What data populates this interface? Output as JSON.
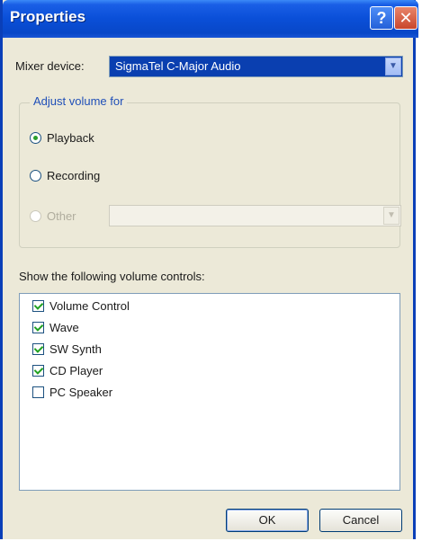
{
  "window": {
    "title": "Properties",
    "help_label": "?",
    "close_label": "✕"
  },
  "mixer": {
    "label": "Mixer device:",
    "value": "SigmaTel C-Major Audio"
  },
  "adjust_volume": {
    "title": "Adjust volume for",
    "options": [
      {
        "label": "Playback",
        "checked": true,
        "enabled": true
      },
      {
        "label": "Recording",
        "checked": false,
        "enabled": true
      },
      {
        "label": "Other",
        "checked": false,
        "enabled": false
      }
    ],
    "other_value": ""
  },
  "controls": {
    "label": "Show the following volume controls:",
    "items": [
      {
        "label": "Volume Control",
        "checked": true
      },
      {
        "label": "Wave",
        "checked": true
      },
      {
        "label": "SW Synth",
        "checked": true
      },
      {
        "label": "CD Player",
        "checked": true
      },
      {
        "label": "PC Speaker",
        "checked": false
      }
    ]
  },
  "buttons": {
    "ok_label": "OK",
    "cancel_label": "Cancel"
  },
  "icons": {
    "dropdown": "chevron-down-icon"
  }
}
